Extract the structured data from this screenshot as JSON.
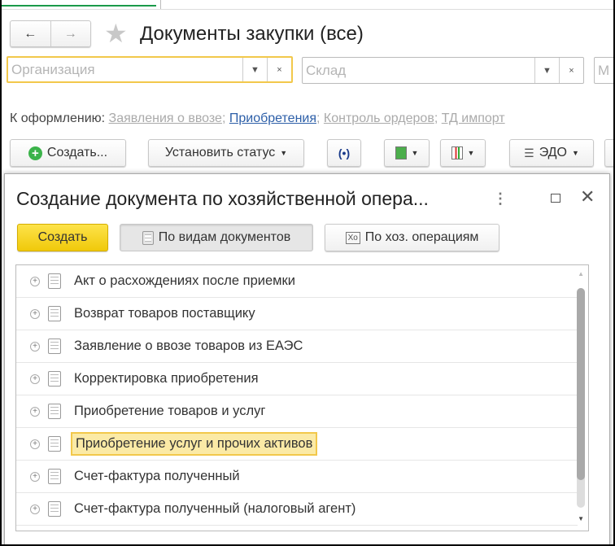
{
  "main": {
    "title": "Документы закупки (все)",
    "nav": {
      "back": "←",
      "forward": "→",
      "favorite": "★"
    },
    "filters": [
      {
        "placeholder": "Организация"
      },
      {
        "placeholder": "Склад"
      },
      {
        "placeholder": "М"
      }
    ],
    "to_process_label": "К оформлению:",
    "to_process_links": [
      "Заявления о ввозе",
      "Приобретения",
      "Контроль ордеров",
      "ТД импорт"
    ],
    "toolbar": {
      "create": "Создать...",
      "set_status": "Установить статус",
      "edo": "ЭДО"
    }
  },
  "dialog": {
    "title": "Создание документа по хозяйственной опера...",
    "create_button": "Создать",
    "by_doc_types": "По видам документов",
    "by_operations": "По хоз. операциям",
    "items": [
      "Акт о расхождениях после приемки",
      "Возврат товаров поставщику",
      "Заявление о ввозе товаров из ЕАЭС",
      "Корректировка приобретения",
      "Приобретение товаров и услуг",
      "Приобретение услуг и прочих активов",
      "Счет-фактура полученный",
      "Счет-фактура полученный (налоговый агент)"
    ],
    "selected_index": 5
  },
  "colors": {
    "accent": "#f2c84b",
    "create_button": "#f5d31c",
    "link": "#2d5fa8"
  }
}
